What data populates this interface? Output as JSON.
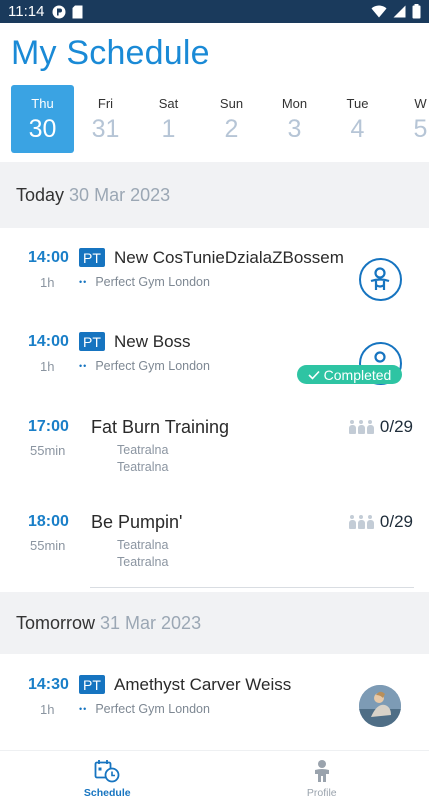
{
  "status_bar": {
    "time": "11:14"
  },
  "page_title": "My Schedule",
  "days": [
    {
      "name": "Thu",
      "num": "30",
      "active": true
    },
    {
      "name": "Fri",
      "num": "31"
    },
    {
      "name": "Sat",
      "num": "1"
    },
    {
      "name": "Sun",
      "num": "2"
    },
    {
      "name": "Mon",
      "num": "3"
    },
    {
      "name": "Tue",
      "num": "4"
    },
    {
      "name": "W",
      "num": "5"
    }
  ],
  "sections": [
    {
      "label": "Today",
      "date": "30 Mar 2023"
    },
    {
      "label": "Tomorrow",
      "date": "31 Mar 2023"
    }
  ],
  "items": [
    {
      "time": "14:00",
      "duration": "1h",
      "badge": "PT",
      "title": "New CosTunieDzialaZBossem",
      "location": "Perfect Gym London"
    },
    {
      "time": "14:00",
      "duration": "1h",
      "badge": "PT",
      "title": "New Boss",
      "location": "Perfect Gym London",
      "status": "Completed"
    },
    {
      "time": "17:00",
      "duration": "55min",
      "title": "Fat Burn Training",
      "loc1": "Teatralna",
      "loc2": "Teatralna",
      "capacity": "0/29"
    },
    {
      "time": "18:00",
      "duration": "55min",
      "title": "Be Pumpin'",
      "loc1": "Teatralna",
      "loc2": "Teatralna",
      "capacity": "0/29"
    },
    {
      "time": "14:30",
      "duration": "1h",
      "badge": "PT",
      "title": "Amethyst Carver Weiss",
      "location": "Perfect Gym London"
    }
  ],
  "nav": {
    "schedule": "Schedule",
    "profile": "Profile"
  },
  "colors": {
    "accent": "#1a8ad6",
    "primary": "#1674c0",
    "success": "#2ec4a3",
    "status_bar": "#1a3a5c"
  }
}
